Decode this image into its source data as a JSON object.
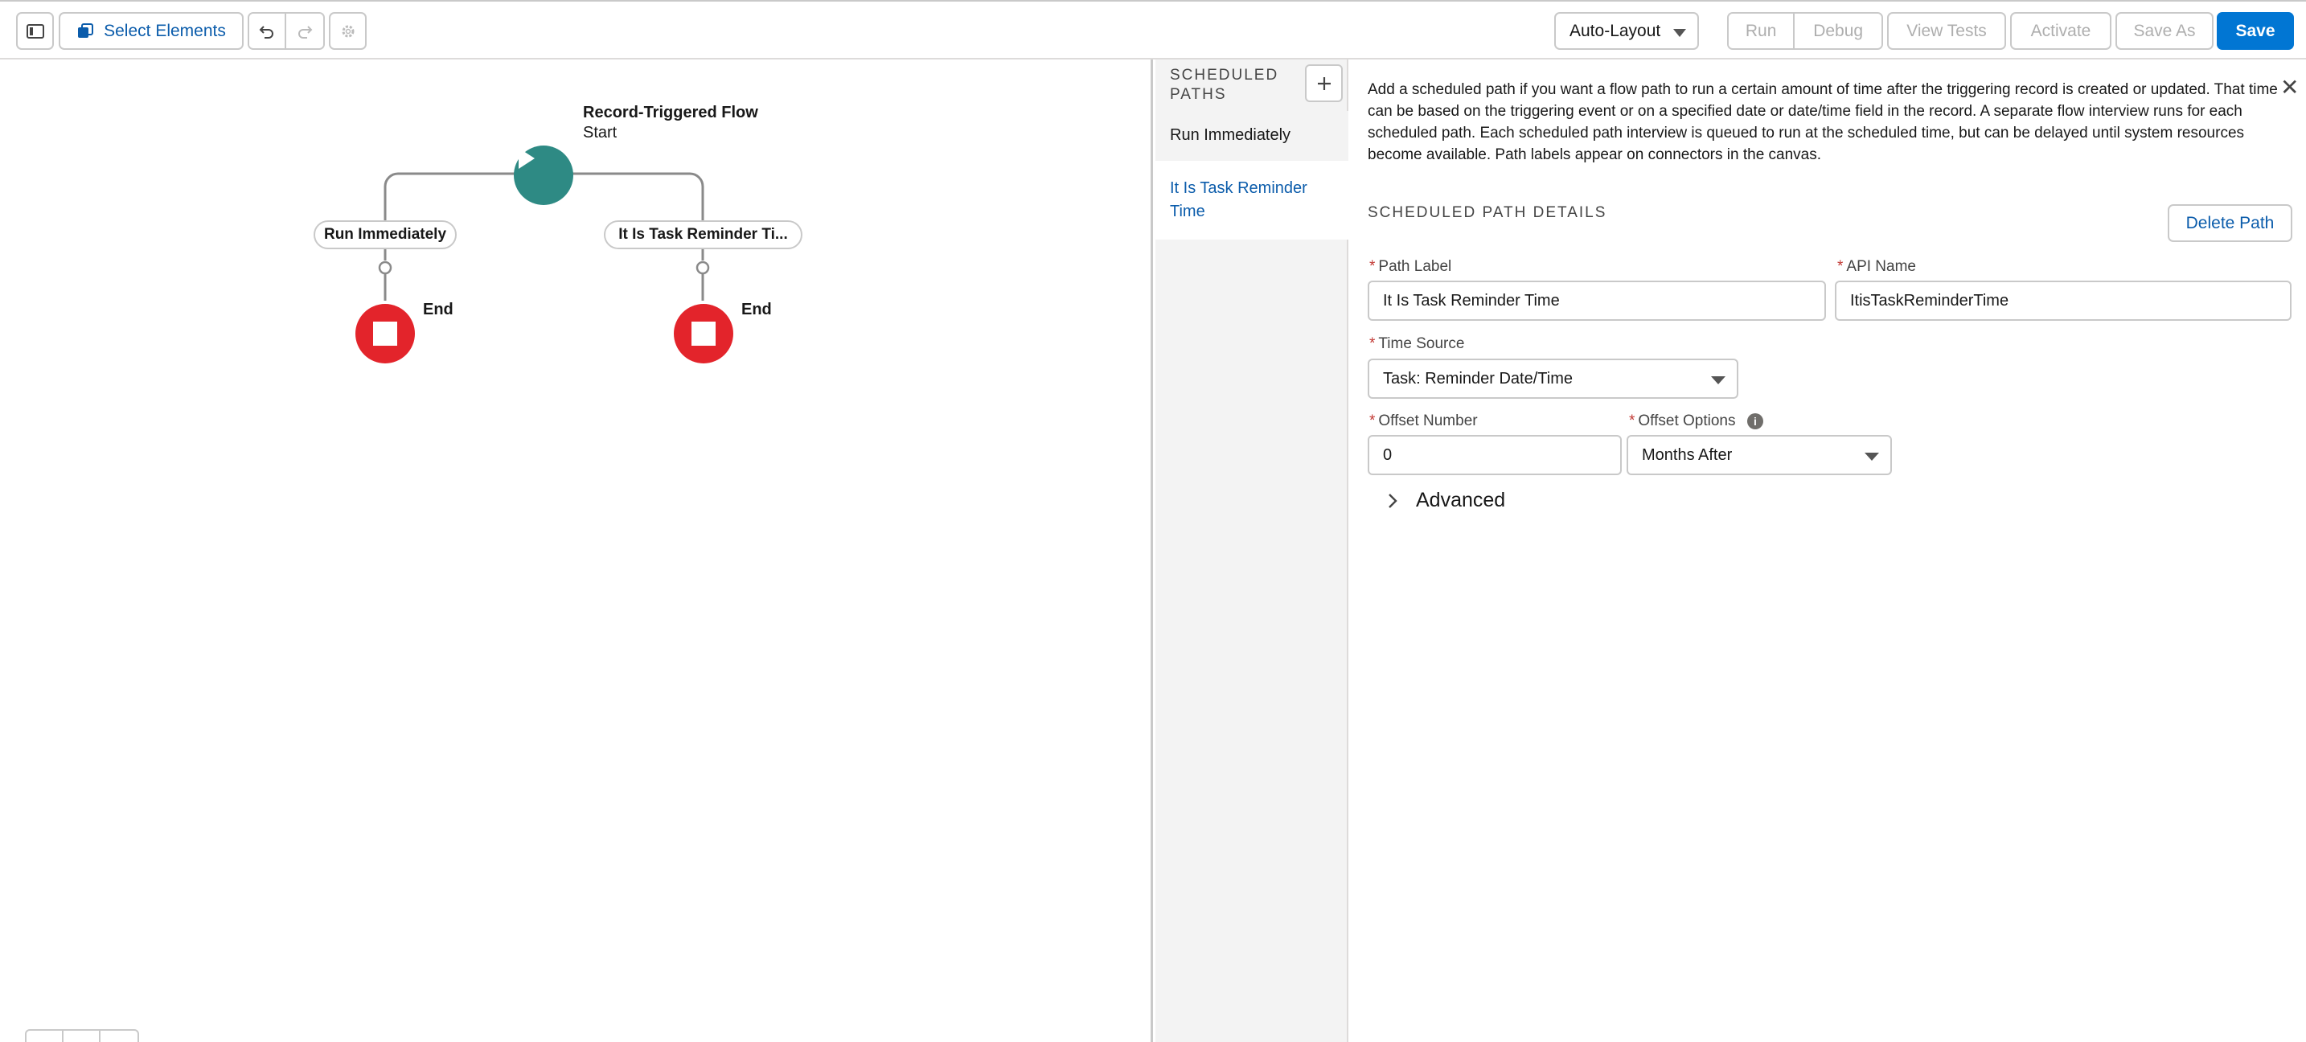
{
  "toolbar": {
    "select_elements": "Select Elements",
    "layout_select": "Auto-Layout",
    "run": "Run",
    "debug": "Debug",
    "view_tests": "View Tests",
    "activate": "Activate",
    "save_as": "Save As",
    "save": "Save"
  },
  "canvas": {
    "start_title": "Record-Triggered Flow",
    "start_sub": "Start",
    "branch_left": "Run Immediately",
    "branch_right": "It Is Task Reminder Ti...",
    "end_left": "End",
    "end_right": "End"
  },
  "pathlist": {
    "heading": "SCHEDULED PATHS",
    "items": [
      {
        "label": "Run Immediately"
      },
      {
        "label": "It Is Task Reminder Time"
      }
    ]
  },
  "details": {
    "description": "Add a scheduled path if you want a flow path to run a certain amount of time after the triggering record is created or updated. That time can be based on the triggering event or on a specified date or date/time field in the record. A separate flow interview runs for each scheduled path. Each scheduled path interview is queued to run at the scheduled time, but can be delayed until system resources become available. Path labels appear on connectors in the canvas.",
    "section_title": "SCHEDULED PATH DETAILS",
    "delete_path": "Delete Path",
    "path_label": {
      "label": "Path Label",
      "value": "It Is Task Reminder Time"
    },
    "api_name": {
      "label": "API Name",
      "value": "ItisTaskReminderTime"
    },
    "time_source": {
      "label": "Time Source",
      "value": "Task: Reminder Date/Time"
    },
    "offset_number": {
      "label": "Offset Number",
      "value": "0"
    },
    "offset_options": {
      "label": "Offset Options",
      "value": "Months After"
    },
    "advanced": "Advanced"
  },
  "colors": {
    "brand": "#0176d3",
    "start_node": "#2e8a84",
    "end_node": "#e3242b"
  }
}
